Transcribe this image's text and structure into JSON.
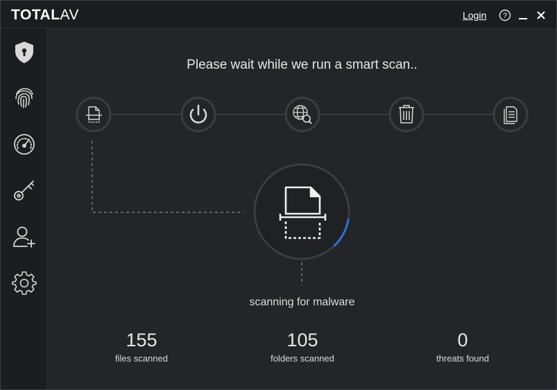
{
  "app": {
    "logo_bold": "TOTAL",
    "logo_light": "AV",
    "login_label": "Login",
    "help_glyph": "?"
  },
  "colors": {
    "accent_blue": "#2f6fd6",
    "ring": "#3a3d42",
    "icon": "#d8d8d8"
  },
  "sidebar": {
    "items": [
      {
        "name": "shield-icon",
        "active": true
      },
      {
        "name": "fingerprint-icon"
      },
      {
        "name": "speedometer-icon"
      },
      {
        "name": "key-icon"
      },
      {
        "name": "add-user-icon"
      },
      {
        "name": "gear-icon"
      }
    ]
  },
  "scan": {
    "headline": "Please wait while we run a smart scan..",
    "status": "scanning for malware",
    "progress": 0.16,
    "steps": [
      {
        "name": "file-scan-icon",
        "active": true
      },
      {
        "name": "power-icon"
      },
      {
        "name": "web-search-icon"
      },
      {
        "name": "trash-icon"
      },
      {
        "name": "document-icon"
      }
    ]
  },
  "stats": {
    "files": {
      "value": "155",
      "label": "files scanned"
    },
    "folders": {
      "value": "105",
      "label": "folders scanned"
    },
    "threats": {
      "value": "0",
      "label": "threats found"
    }
  }
}
